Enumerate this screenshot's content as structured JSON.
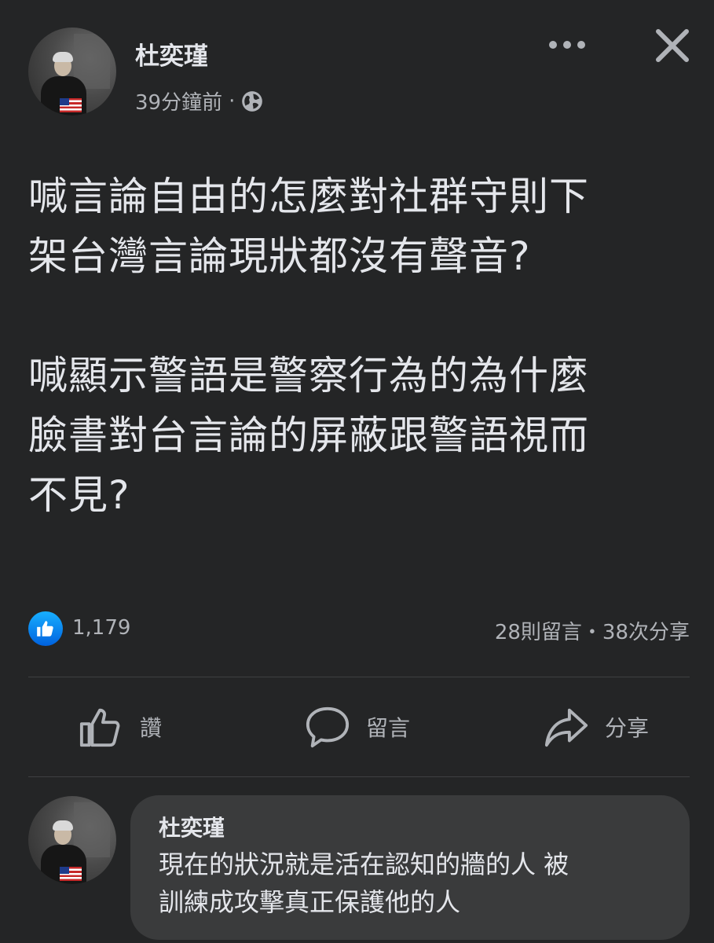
{
  "post": {
    "author": "杜奕瑾",
    "time": "39分鐘前",
    "separator": "·",
    "text": "喊言論自由的怎麼對社群守則下\n架台灣言論現狀都沒有聲音?\n\n喊顯示警語是警察行為的為什麼\n臉書對台言論的屏蔽跟警語視而\n不見?",
    "reactions_count": "1,179",
    "comments_shares": "28則留言・38次分享"
  },
  "actions": {
    "like": "讚",
    "comment": "留言",
    "share": "分享"
  },
  "comment": {
    "author": "杜奕瑾",
    "text": "現在的狀況就是活在認知的牆的人 被\n訓練成攻擊真正保護他的人"
  },
  "icons": {
    "more": "more-options-icon",
    "close": "close-icon",
    "audience": "globe-icon",
    "reaction": "like-reaction-icon",
    "like": "thumbs-up-icon",
    "comment": "speech-bubble-icon",
    "share": "share-arrow-icon"
  },
  "colors": {
    "background": "#242526",
    "text": "#e4e6eb",
    "secondary_text": "#b0b3b8",
    "like_blue": "#1877f2",
    "comment_bubble": "#3a3b3c"
  }
}
